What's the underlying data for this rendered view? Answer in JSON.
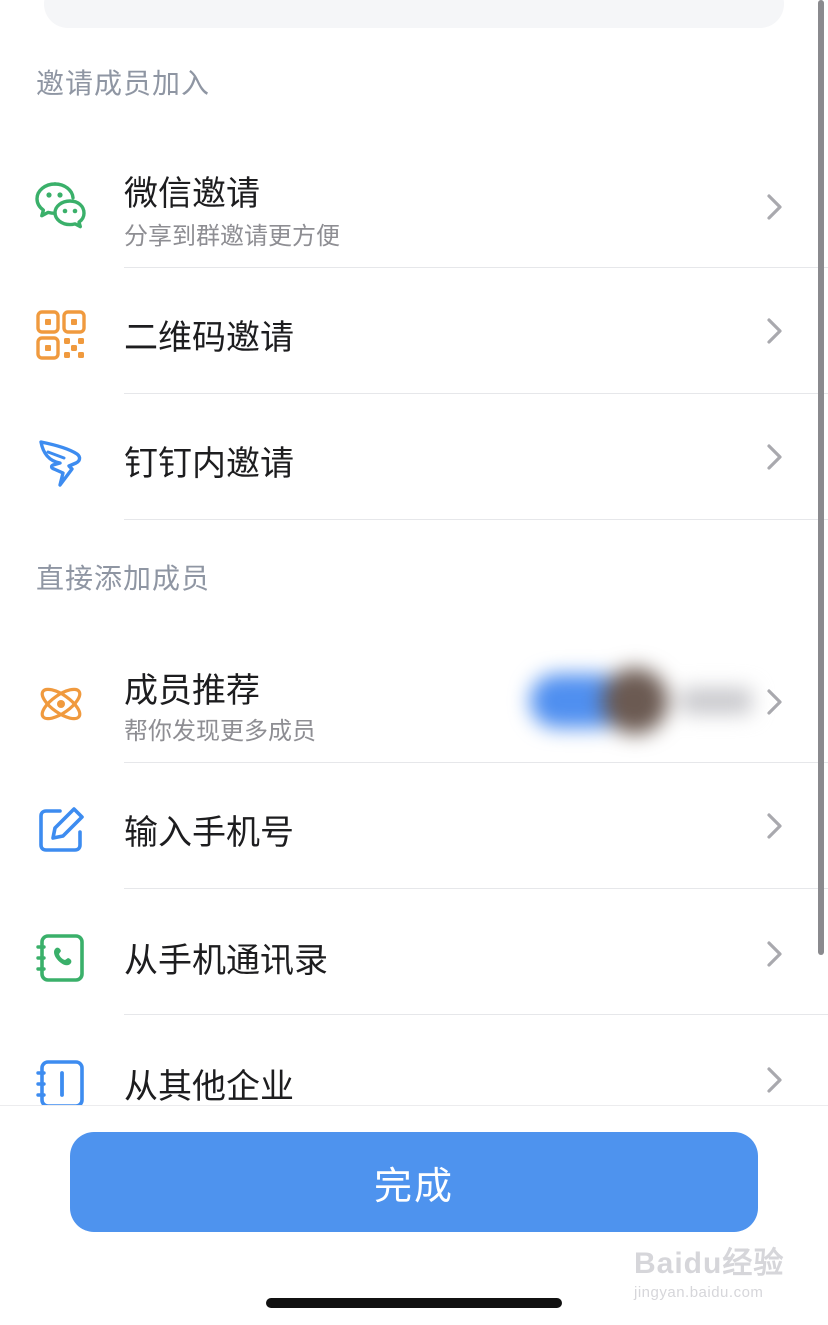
{
  "sections": {
    "invite": "邀请成员加入",
    "direct": "直接添加成员"
  },
  "items": {
    "wechat": {
      "title": "微信邀请",
      "subtitle": "分享到群邀请更方便",
      "icon": "wechat-icon",
      "color": "#3ab06a"
    },
    "qrcode": {
      "title": "二维码邀请",
      "icon": "qrcode-icon",
      "color": "#f09a3e"
    },
    "dingtalk": {
      "title": "钉钉内邀请",
      "icon": "dingtalk-icon",
      "color": "#3d8cf0"
    },
    "recommend": {
      "title": "成员推荐",
      "subtitle": "帮你发现更多成员",
      "icon": "atom-icon",
      "color": "#f09a3e"
    },
    "phone": {
      "title": "输入手机号",
      "icon": "edit-icon",
      "color": "#3d8cf0"
    },
    "contacts": {
      "title": "从手机通讯录",
      "icon": "phone-book-icon",
      "color": "#3ab06a"
    },
    "enterprise": {
      "title": "从其他企业",
      "icon": "org-book-icon",
      "color": "#3d8cf0"
    }
  },
  "footer": {
    "done_label": "完成"
  },
  "watermark": {
    "brand": "Baidu经验",
    "url": "jingyan.baidu.com"
  }
}
